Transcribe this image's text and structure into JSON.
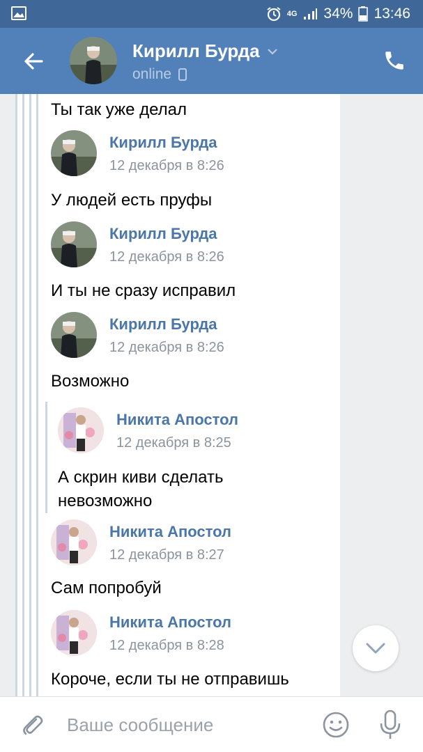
{
  "status_bar": {
    "network": "4G",
    "battery": "34%",
    "time": "13:46"
  },
  "header": {
    "name": "Кирилл Бурда",
    "status": "online"
  },
  "messages": [
    {
      "text": "Ты так уже делал"
    },
    {
      "author": "Кирилл Бурда",
      "date": "12 декабря в 8:26",
      "text": "У людей есть пруфы"
    },
    {
      "author": "Кирилл Бурда",
      "date": "12 декабря в 8:26",
      "text": "И ты не сразу исправил"
    },
    {
      "author": "Кирилл Бурда",
      "date": "12 декабря в 8:26",
      "text": "Возможно"
    },
    {
      "author": "Никита Апостол",
      "date": "12 декабря в 8:25",
      "text_line1": "А скрин киви сделать",
      "text_line2": "невозможно"
    },
    {
      "author": "Никита Апостол",
      "date": "12 декабря в 8:27",
      "text": "Сам попробуй"
    },
    {
      "author": "Никита Апостол",
      "date": "12 декабря в 8:28",
      "text": "Короче, если ты не отправишь"
    }
  ],
  "composer": {
    "placeholder": "Ваше сообщение"
  },
  "colors": {
    "header": "#5181b8",
    "status_bar": "#3f6899",
    "link": "#4a76a8"
  }
}
